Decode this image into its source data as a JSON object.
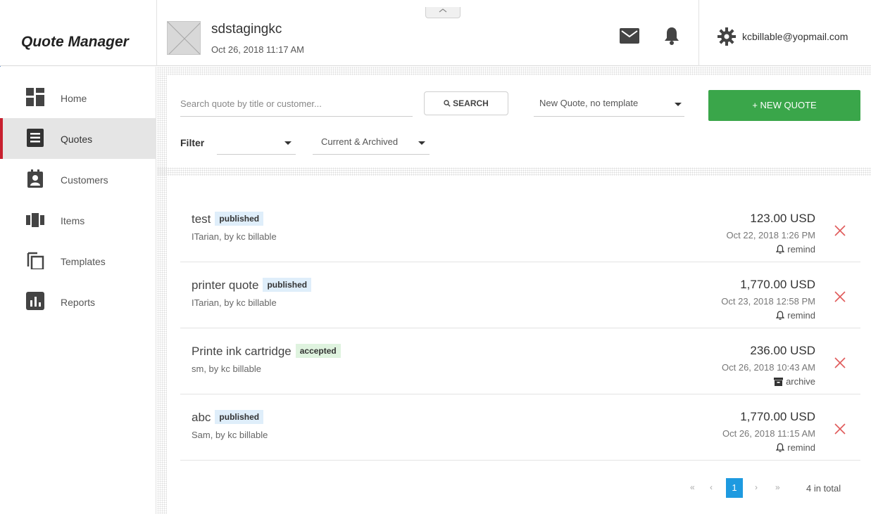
{
  "header": {
    "app_title": "Quote Manager",
    "org_name": "sdstagingkc",
    "org_datetime": "Oct 26, 2018 11:17 AM",
    "user_email": "kcbillable@yopmail.com"
  },
  "sidebar": {
    "items": [
      {
        "label": "Home",
        "icon": "home-icon",
        "active": false
      },
      {
        "label": "Quotes",
        "icon": "quotes-icon",
        "active": true
      },
      {
        "label": "Customers",
        "icon": "customers-icon",
        "active": false
      },
      {
        "label": "Items",
        "icon": "items-icon",
        "active": false
      },
      {
        "label": "Templates",
        "icon": "templates-icon",
        "active": false
      },
      {
        "label": "Reports",
        "icon": "reports-icon",
        "active": false
      }
    ]
  },
  "toolbar": {
    "search_placeholder": "Search quote by title or customer...",
    "search_label": "SEARCH",
    "template_select": "New Quote, no template",
    "new_quote_label": "+ NEW QUOTE",
    "filter_label": "Filter",
    "filter_value": "",
    "status_select": "Current & Archived"
  },
  "quotes": [
    {
      "title": "test",
      "status": "published",
      "sub": "ITarian, by kc billable",
      "amount": "123.00 USD",
      "date": "Oct 22, 2018 1:26 PM",
      "action": "remind"
    },
    {
      "title": "printer quote",
      "status": "published",
      "sub": "ITarian, by kc billable",
      "amount": "1,770.00 USD",
      "date": "Oct 23, 2018 12:58 PM",
      "action": "remind"
    },
    {
      "title": "Printe ink cartridge",
      "status": "accepted",
      "sub": "sm, by kc billable",
      "amount": "236.00 USD",
      "date": "Oct 26, 2018 10:43 AM",
      "action": "archive"
    },
    {
      "title": "abc",
      "status": "published",
      "sub": "Sam, by kc billable",
      "amount": "1,770.00 USD",
      "date": "Oct 26, 2018 11:15 AM",
      "action": "remind"
    }
  ],
  "pagination": {
    "first": "«",
    "prev": "‹",
    "current": "1",
    "next": "›",
    "last": "»",
    "total": "4 in total"
  },
  "colors": {
    "accent_green": "#3aa64a",
    "active_red": "#c8202f",
    "page_blue": "#1e9ae0",
    "delete_red": "#e05a5a"
  }
}
